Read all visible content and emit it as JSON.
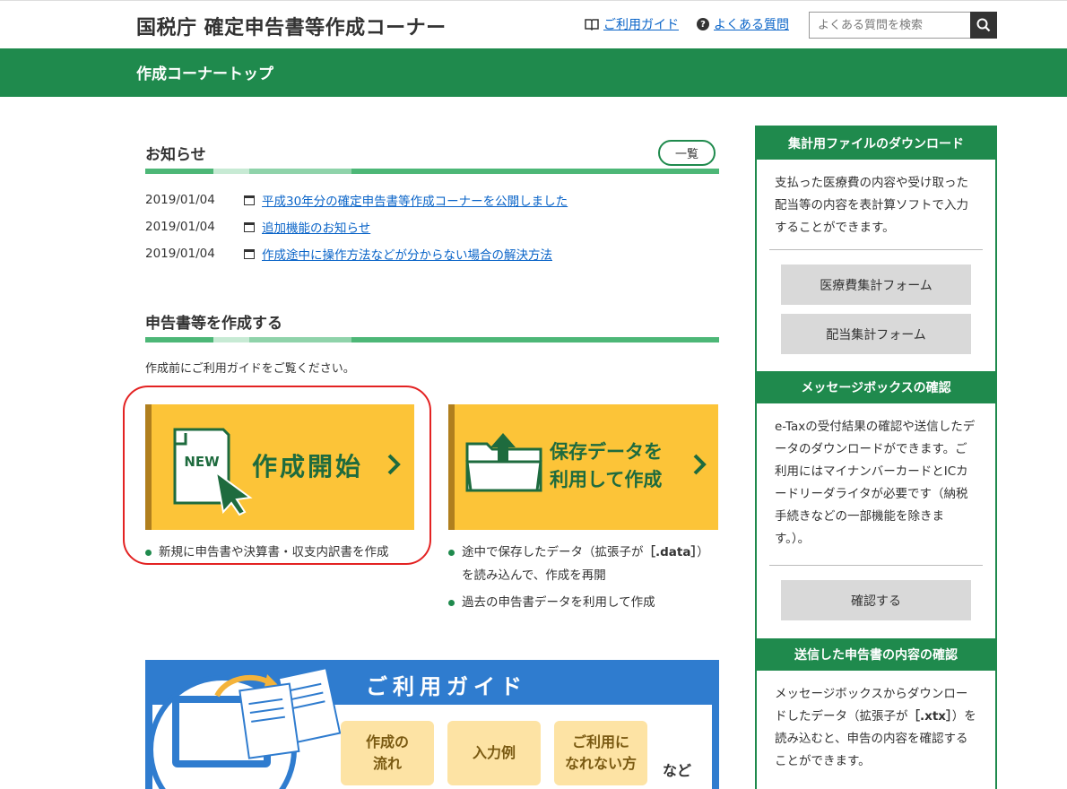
{
  "header": {
    "site_title": "国税庁 確定申告書等作成コーナー",
    "guide_link": "ご利用ガイド",
    "faq_link": "よくある質問",
    "faq_icon": "?",
    "search_placeholder": "よくある質問を検索"
  },
  "nav": {
    "title": "作成コーナートップ"
  },
  "news": {
    "title": "お知らせ",
    "list_button": "一覧",
    "items": [
      {
        "date": "2019/01/04",
        "text": "平成30年分の確定申告書等作成コーナーを公開しました"
      },
      {
        "date": "2019/01/04",
        "text": "追加機能のお知らせ"
      },
      {
        "date": "2019/01/04",
        "text": "作成途中に操作方法などが分からない場合の解決方法"
      }
    ]
  },
  "create": {
    "title": "申告書等を作成する",
    "note": "作成前にご利用ガイドをご覧ください。",
    "start_card": {
      "label": "作成開始",
      "badge": "NEW"
    },
    "saved_card": {
      "line1": "保存データを",
      "line2": "利用して作成"
    },
    "start_bullets": [
      "新規に申告書や決算書・収支内訳書を作成"
    ],
    "saved_bullets": [
      {
        "pre": "途中で保存したデータ（拡張子が",
        "code": "［.data］",
        "post": "）",
        "line2": "を読み込んで、作成を再開"
      },
      {
        "pre": "過去の申告書データを利用して作成"
      }
    ]
  },
  "guide_banner": {
    "title": "ご利用ガイド",
    "buttons": [
      {
        "line1": "作成の",
        "line2": "流れ"
      },
      {
        "line1": "入力例",
        "line2": ""
      },
      {
        "line1": "ご利用に",
        "line2": "なれない方"
      }
    ],
    "etc": "など"
  },
  "sidebar": {
    "download": {
      "title": "集計用ファイルのダウンロード",
      "text": "支払った医療費の内容や受け取った配当等の内容を表計算ソフトで入力することができます。",
      "buttons": [
        "医療費集計フォーム",
        "配当集計フォーム"
      ]
    },
    "messagebox": {
      "title": "メッセージボックスの確認",
      "text": "e-Taxの受付結果の確認や送信したデータのダウンロードができます。ご利用にはマイナンバーカードとICカードリーダライタが必要です（納税手続きなどの一部機能を除きます。）。",
      "button": "確認する"
    },
    "sent": {
      "title": "送信した申告書の内容の確認",
      "text_pre": "メッセージボックスからダウンロードしたデータ（拡張子が",
      "text_code": "［.xtx］",
      "text_post": "）を読み込むと、申告の内容を確認することができます。"
    }
  },
  "colors": {
    "green": "#1f8a4d",
    "yellow": "#fcc438",
    "link": "#0a64c8",
    "guide_blue": "#2f7ccf"
  }
}
